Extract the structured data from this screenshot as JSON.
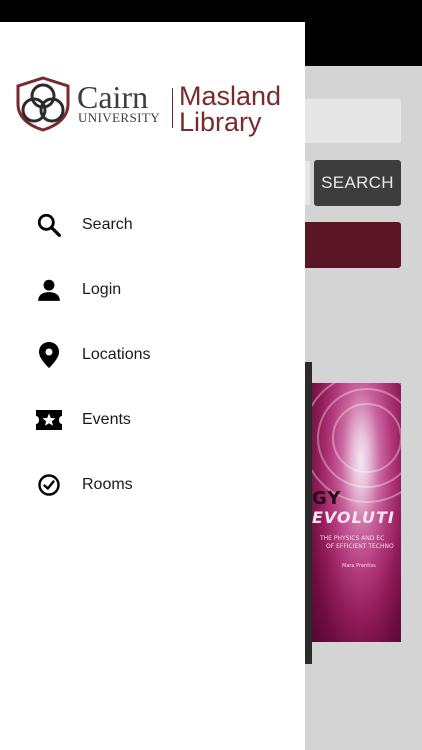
{
  "background": {
    "search_button_label": "SEARCH",
    "book_cover": {
      "title_line1": "GY",
      "title_line2": "EVOLUTI",
      "subtitle_line1": "THE PHYSICS AND EC",
      "subtitle_line2": "OF EFFICIENT TECHNO",
      "author": "Mara Prentiss"
    }
  },
  "logo": {
    "name": "Cairn",
    "sub": "UNIVERSITY",
    "library_line1": "Masland",
    "library_line2": "Library"
  },
  "menu": {
    "items": [
      {
        "label": "Search",
        "icon": "search-icon"
      },
      {
        "label": "Login",
        "icon": "person-icon"
      },
      {
        "label": "Locations",
        "icon": "location-pin-icon"
      },
      {
        "label": "Events",
        "icon": "ticket-star-icon"
      },
      {
        "label": "Rooms",
        "icon": "clock-check-icon"
      }
    ]
  },
  "colors": {
    "brand_maroon": "#7a2a2c",
    "dark_button": "#3d3d3d",
    "maroon_button": "#5a1624"
  }
}
